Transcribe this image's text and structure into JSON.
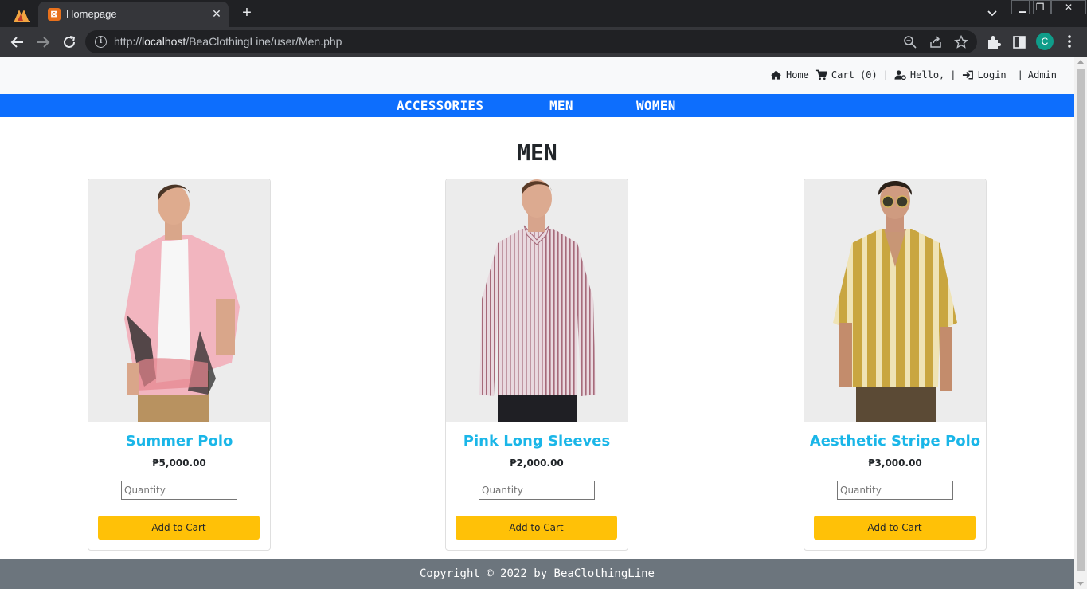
{
  "browser": {
    "tab_title": "Homepage",
    "tab_favicon_text": "☒",
    "url_host": "localhost",
    "url_prefix": "http://",
    "url_path": "/BeaClothingLine/user/Men.php",
    "profile_initial": "C"
  },
  "topbar": {
    "home": "Home",
    "cart": "Cart (0)",
    "sep1": "|",
    "hello": "Hello,",
    "sep2": "|",
    "login": "Login",
    "sep3": "|",
    "admin": "Admin"
  },
  "nav": {
    "accessories": "ACCESSORIES",
    "men": "MEN",
    "women": "WOMEN"
  },
  "page": {
    "heading": "MEN"
  },
  "products": [
    {
      "name": "Summer Polo",
      "price": "₱5,000.00",
      "qty_placeholder": "Quantity",
      "button": "Add to Cart"
    },
    {
      "name": "Pink Long Sleeves",
      "price": "₱2,000.00",
      "qty_placeholder": "Quantity",
      "button": "Add to Cart"
    },
    {
      "name": "Aesthetic Stripe Polo",
      "price": "₱3,000.00",
      "qty_placeholder": "Quantity",
      "button": "Add to Cart"
    }
  ],
  "footer": {
    "text": "Copyright © 2022 by BeaClothingLine"
  },
  "colors": {
    "navbar": "#0d6efd",
    "title": "#1ab6e8",
    "button": "#ffc107",
    "footer": "#6c757d"
  }
}
